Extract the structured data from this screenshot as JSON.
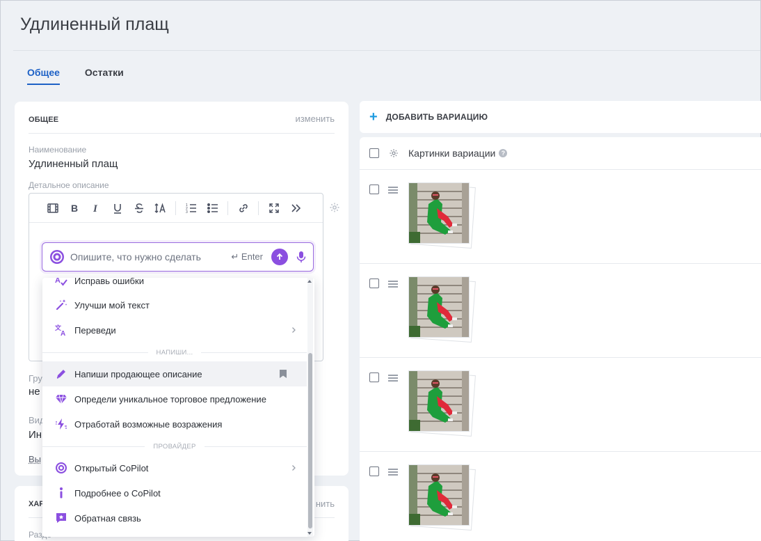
{
  "page": {
    "title": "Удлиненный плащ"
  },
  "tabs": [
    {
      "label": "Общее",
      "active": true
    },
    {
      "label": "Остатки",
      "active": false
    }
  ],
  "general": {
    "section_title": "ОБЩЕЕ",
    "edit_label": "изменить",
    "name_label": "Наименование",
    "name_value": "Удлиненный плащ",
    "description_label": "Детальное описание",
    "truncated": {
      "group_label": "Гру",
      "group_value": "не",
      "type_label": "Вид",
      "type_value": "Ин",
      "link": "Вы"
    }
  },
  "card2": {
    "title_fragment": "ХАР",
    "edit_fragment": "нить",
    "sub_fragment": "Разде"
  },
  "editor_toolbar": [
    "film-icon",
    "bold-icon",
    "italic-icon",
    "underline-icon",
    "strikethrough-icon",
    "text-size-icon",
    "ordered-list-icon",
    "bullet-list-icon",
    "link-icon",
    "fullscreen-icon",
    "more-icon"
  ],
  "ai": {
    "placeholder": "Опишите, что нужно сделать",
    "enter_hint": "Enter",
    "accent": "#8b4fe0"
  },
  "menu": {
    "items_top": [
      {
        "label": "Исправь ошибки",
        "icon": "spellcheck-icon"
      },
      {
        "label": "Улучши мой текст",
        "icon": "magic-wand-icon"
      },
      {
        "label": "Переведи",
        "icon": "translate-icon",
        "submenu": true
      }
    ],
    "sep_write": "НАПИШИ...",
    "items_write": [
      {
        "label": "Напиши продающее описание",
        "icon": "pen-icon",
        "bookmark": true
      },
      {
        "label": "Определи уникальное торговое предложение",
        "icon": "diamond-icon"
      },
      {
        "label": "Отработай возможные возражения",
        "icon": "lightning-icon"
      }
    ],
    "sep_provider": "ПРОВАЙДЕР",
    "items_provider": [
      {
        "label": "Открытый CoPilot",
        "icon": "copilot-icon",
        "submenu": true
      },
      {
        "label": "Подробнее о CoPilot",
        "icon": "info-icon"
      },
      {
        "label": "Обратная связь",
        "icon": "feedback-icon"
      }
    ]
  },
  "variations": {
    "add_label": "ДОБАВИТЬ ВАРИАЦИЮ",
    "images_header": "Картинки вариации",
    "help_mark": "?",
    "plus": "+",
    "rows": 4
  }
}
